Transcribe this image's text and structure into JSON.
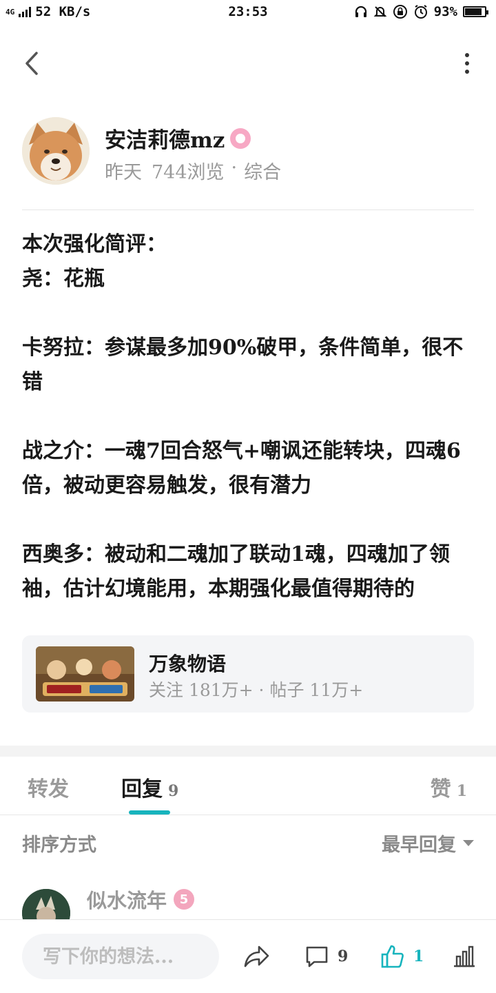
{
  "status_bar": {
    "network": "4G",
    "speed": "52 KB/s",
    "time": "23:53",
    "battery": "93%",
    "battery_level": 0.93
  },
  "topbar": {
    "back_icon": "chevron-left-icon",
    "more_icon": "more-vertical-icon"
  },
  "author": {
    "name": "安洁莉德mz",
    "time": "昨天",
    "views": "744浏览",
    "separator": "·",
    "category": "综合"
  },
  "post": {
    "paragraphs": [
      "本次强化简评：\n尧：花瓶",
      "卡努拉：参谋最多加90%破甲，条件简单，很不错",
      "战之介：一魂7回合怒气+嘲讽还能转块，四魂6倍，被动更容易触发，很有潜力",
      "西奥多：被动和二魂加了联动1魂，四魂加了领袖，估计幻境能用，本期强化最值得期待的"
    ]
  },
  "game_card": {
    "name": "万象物语",
    "stats": "关注 181万+ · 帖子 11万+"
  },
  "tabs": {
    "forward": "转发",
    "reply": "回复",
    "reply_count": "9",
    "like": "赞",
    "like_count": "1"
  },
  "sort": {
    "label": "排序方式",
    "value": "最早回复"
  },
  "reply": {
    "name": "似水流年",
    "level": "5"
  },
  "bottom_bar": {
    "input_placeholder": "写下你的想法...",
    "comment_count": "9",
    "like_count": "1",
    "accent_color": "#17b4bd"
  }
}
